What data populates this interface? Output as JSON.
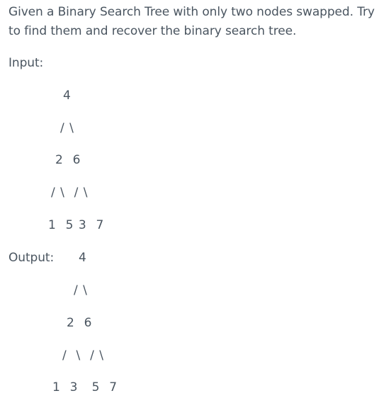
{
  "problem": {
    "line1": "Given a Binary Search Tree with only two nodes swapped. Try",
    "line2": "to find them and recover the binary search tree."
  },
  "input": {
    "label": "Input:",
    "rows": [
      "4",
      "/ \\",
      "2  6",
      "/ \\  / \\",
      "1  5 3  7"
    ]
  },
  "output": {
    "label": "Output:",
    "rows": [
      "4",
      "/ \\",
      "2  6",
      "/  \\  / \\",
      "1  3   5  7"
    ]
  }
}
